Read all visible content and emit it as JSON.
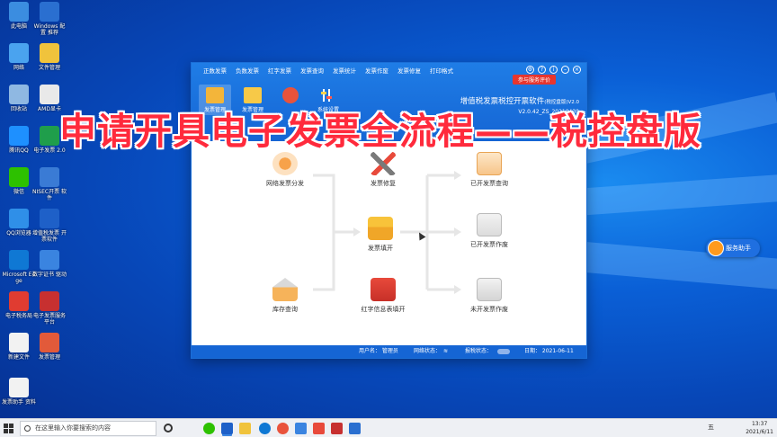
{
  "desktop": {
    "icons": [
      {
        "label": "此电脑",
        "color": "#3b8de0"
      },
      {
        "label": "Windows 配置 推荐",
        "color": "#2a6fd0"
      },
      {
        "label": "网络",
        "color": "#4aa3ef"
      },
      {
        "label": "文件管理",
        "color": "#f0c33c"
      },
      {
        "label": "回收站",
        "color": "#8fb8e2"
      },
      {
        "label": "AMD显卡",
        "color": "#e9e9e9"
      },
      {
        "label": "腾讯QQ",
        "color": "#1e90ff"
      },
      {
        "label": "电子发票 2.0",
        "color": "#1f9e4b"
      },
      {
        "label": "微信",
        "color": "#2dc100"
      },
      {
        "label": "NISEC开票 软件",
        "color": "#3a7bd5"
      },
      {
        "label": "QQ浏览器",
        "color": "#2f8fe8"
      },
      {
        "label": "增值税发票 开票软件",
        "color": "#1e60c8"
      },
      {
        "label": "Microsoft Edge",
        "color": "#0f78d4"
      },
      {
        "label": "数字证书 驱动",
        "color": "#3a84e0"
      },
      {
        "label": "电子税务局",
        "color": "#e03c31"
      },
      {
        "label": "电子发票服务 平台",
        "color": "#c73030"
      },
      {
        "label": "新建文件",
        "color": "#f2f2f2"
      },
      {
        "label": "发票管理",
        "color": "#e25a3a"
      },
      {
        "label": "发票助手 资料",
        "color": "#f2f2f2"
      }
    ]
  },
  "window": {
    "menu": [
      "正数发票",
      "负数发票",
      "红字发票",
      "发票查询",
      "发票统计",
      "发票作废",
      "发票修复",
      "打印格式"
    ],
    "service_button": "参与服务评价",
    "toolbar": [
      {
        "label": "发票管理",
        "color": "#f3b53a"
      },
      {
        "label": "发票管理",
        "color": "#f7c948"
      },
      {
        "label": "",
        "color": "#e9533c"
      },
      {
        "label": "系统设置",
        "color": "#ffffff"
      }
    ],
    "brand_title": "增值税发票税控开票软件",
    "brand_edition": "(税控盘版)V2.0",
    "brand_version": "V2.0.42_ZS_20210430",
    "flow": {
      "nodes": {
        "network_dist": "网络发票分发",
        "repair": "发票修复",
        "issued_query": "已开发票查询",
        "fill": "发票填开",
        "issued_void": "已开发票作废",
        "stock_query": "库存查询",
        "red_info": "红字信息表填开",
        "unissued_void": "未开发票作废"
      }
    },
    "status": {
      "user": "用户名： 管理员",
      "network": "网络状态：",
      "tax_status": "报税状态：",
      "date": "日期： 2021-06-11"
    }
  },
  "overlay_title": "申请开具电子发票全流程——税控盘版",
  "assistant": "服务助手",
  "taskbar": {
    "search_placeholder": "在这里输入你要搜索的内容",
    "time": "13:37",
    "date": "2021/6/11",
    "ime": "五"
  }
}
